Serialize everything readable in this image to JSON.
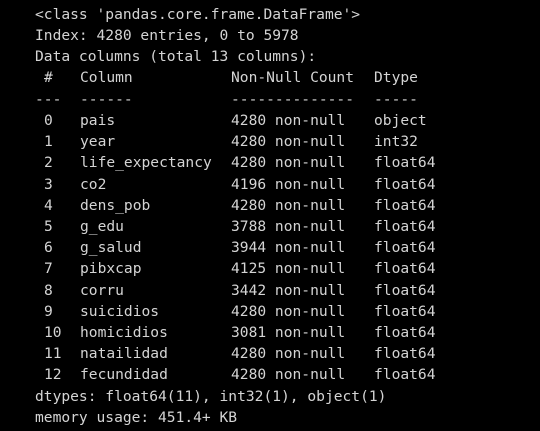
{
  "output": {
    "class_line": "<class 'pandas.core.frame.DataFrame'>",
    "index_line": "Index: 4280 entries, 0 to 5978",
    "columns_line": "Data columns (total 13 columns):",
    "header": {
      "hash": "#",
      "column": "Column",
      "count": "Non-Null Count",
      "dtype": "Dtype"
    },
    "separator": {
      "hash": "---",
      "column": "------",
      "count": "--------------",
      "dtype": "-----"
    },
    "rows": [
      {
        "idx": "0",
        "name": "pais",
        "count": "4280 non-null",
        "dtype": "object"
      },
      {
        "idx": "1",
        "name": "year",
        "count": "4280 non-null",
        "dtype": "int32"
      },
      {
        "idx": "2",
        "name": "life_expectancy",
        "count": "4280 non-null",
        "dtype": "float64"
      },
      {
        "idx": "3",
        "name": "co2",
        "count": "4196 non-null",
        "dtype": "float64"
      },
      {
        "idx": "4",
        "name": "dens_pob",
        "count": "4280 non-null",
        "dtype": "float64"
      },
      {
        "idx": "5",
        "name": "g_edu",
        "count": "3788 non-null",
        "dtype": "float64"
      },
      {
        "idx": "6",
        "name": "g_salud",
        "count": "3944 non-null",
        "dtype": "float64"
      },
      {
        "idx": "7",
        "name": "pibxcap",
        "count": "4125 non-null",
        "dtype": "float64"
      },
      {
        "idx": "8",
        "name": "corru",
        "count": "3442 non-null",
        "dtype": "float64"
      },
      {
        "idx": "9",
        "name": "suicidios",
        "count": "4280 non-null",
        "dtype": "float64"
      },
      {
        "idx": "10",
        "name": "homicidios",
        "count": "3081 non-null",
        "dtype": "float64"
      },
      {
        "idx": "11",
        "name": "natailidad",
        "count": "4280 non-null",
        "dtype": "float64"
      },
      {
        "idx": "12",
        "name": "fecundidad",
        "count": "4280 non-null",
        "dtype": "float64"
      }
    ],
    "dtypes_line": "dtypes: float64(11), int32(1), object(1)",
    "memory_line": "memory usage: 451.4+ KB"
  }
}
